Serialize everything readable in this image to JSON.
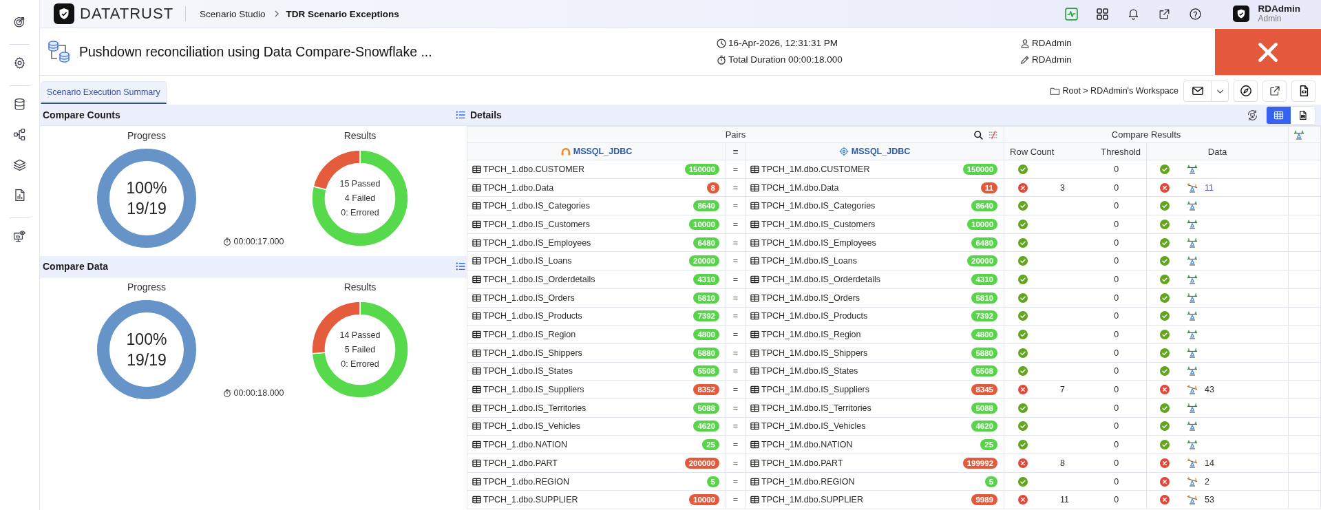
{
  "app_bar": {
    "logo": "DATATRUST",
    "breadcrumb": [
      {
        "label": "Scenario Studio",
        "current": false
      },
      {
        "label": "TDR Scenario Exceptions",
        "current": true
      }
    ],
    "user": {
      "name": "RDAdmin",
      "role": "Admin"
    }
  },
  "scenario": {
    "title": "Pushdown reconciliation using Data Compare-Snowflake ...",
    "run_time": "16-Apr-2026, 12:31:31 PM",
    "total_duration": "Total Duration 00:00:18.000",
    "owner": "RDAdmin",
    "modified_by": "RDAdmin",
    "failed": true
  },
  "tabs": [
    {
      "label": "Scenario Execution Summary",
      "selected": true
    }
  ],
  "workspace_path": "Root > RDAdmin's Workspace",
  "summary_panels": [
    {
      "title": "Compare Counts",
      "progress": {
        "label": "Progress",
        "percent": "100%",
        "count": "19/19",
        "level": 1
      },
      "results": {
        "label": "Results",
        "chart_data": {
          "type": "donut",
          "categories": [
            "15 Passed",
            "4 Failed",
            "0: Errored"
          ],
          "values": [
            15,
            4,
            0
          ]
        }
      },
      "elapsed": "00:00:17.000"
    },
    {
      "title": "Compare Data",
      "progress": {
        "label": "Progress",
        "percent": "100%",
        "count": "19/19",
        "level": 1
      },
      "results": {
        "label": "Results",
        "chart_data": {
          "type": "donut",
          "categories": [
            "14 Passed",
            "5 Failed",
            "0: Errored"
          ],
          "values": [
            14,
            5,
            0
          ]
        }
      },
      "elapsed": "00:00:18.000"
    }
  ],
  "details": {
    "title": "Details",
    "view_modes": [
      {
        "kind": "table",
        "selected": true
      },
      {
        "kind": "report",
        "selected": false
      }
    ],
    "group_headers": [
      "Pairs",
      "Compare Results"
    ],
    "columns": {
      "source": "MSSQL_JDBC",
      "operator": "=",
      "target": "MSSQL_JDBC",
      "row_count": "Row Count",
      "threshold": "Threshold",
      "data": "Data"
    },
    "rows": [
      {
        "source_table": "TPCH_1.dbo.CUSTOMER",
        "source_count": "150000",
        "operator": "=",
        "target_table": "TPCH_1M.dbo.CUSTOMER",
        "target_count": "150000",
        "row_count": {
          "passed": true,
          "threshold": "0"
        },
        "data": {
          "passed": true
        }
      },
      {
        "source_table": "TPCH_1.dbo.Data",
        "source_count": "8",
        "operator": "=",
        "target_table": "TPCH_1M.dbo.Data",
        "target_count": "11",
        "row_count": {
          "passed": false,
          "difference": "3",
          "threshold": "0"
        },
        "data": {
          "passed": false,
          "difference": "11",
          "link": true
        }
      },
      {
        "source_table": "TPCH_1.dbo.IS_Categories",
        "source_count": "8640",
        "operator": "=",
        "target_table": "TPCH_1M.dbo.IS_Categories",
        "target_count": "8640",
        "row_count": {
          "passed": true,
          "threshold": "0"
        },
        "data": {
          "passed": true
        }
      },
      {
        "source_table": "TPCH_1.dbo.IS_Customers",
        "source_count": "10000",
        "operator": "=",
        "target_table": "TPCH_1M.dbo.IS_Customers",
        "target_count": "10000",
        "row_count": {
          "passed": true,
          "threshold": "0"
        },
        "data": {
          "passed": true
        }
      },
      {
        "source_table": "TPCH_1.dbo.IS_Employees",
        "source_count": "6480",
        "operator": "=",
        "target_table": "TPCH_1M.dbo.IS_Employees",
        "target_count": "6480",
        "row_count": {
          "passed": true,
          "threshold": "0"
        },
        "data": {
          "passed": true
        }
      },
      {
        "source_table": "TPCH_1.dbo.IS_Loans",
        "source_count": "20000",
        "operator": "=",
        "target_table": "TPCH_1M.dbo.IS_Loans",
        "target_count": "20000",
        "row_count": {
          "passed": true,
          "threshold": "0"
        },
        "data": {
          "passed": true
        }
      },
      {
        "source_table": "TPCH_1.dbo.IS_Orderdetails",
        "source_count": "4310",
        "operator": "=",
        "target_table": "TPCH_1M.dbo.IS_Orderdetails",
        "target_count": "4310",
        "row_count": {
          "passed": true,
          "threshold": "0"
        },
        "data": {
          "passed": true
        }
      },
      {
        "source_table": "TPCH_1.dbo.IS_Orders",
        "source_count": "5810",
        "operator": "=",
        "target_table": "TPCH_1M.dbo.IS_Orders",
        "target_count": "5810",
        "row_count": {
          "passed": true,
          "threshold": "0"
        },
        "data": {
          "passed": true
        }
      },
      {
        "source_table": "TPCH_1.dbo.IS_Products",
        "source_count": "7392",
        "operator": "=",
        "target_table": "TPCH_1M.dbo.IS_Products",
        "target_count": "7392",
        "row_count": {
          "passed": true,
          "threshold": "0"
        },
        "data": {
          "passed": true
        }
      },
      {
        "source_table": "TPCH_1.dbo.IS_Region",
        "source_count": "4800",
        "operator": "=",
        "target_table": "TPCH_1M.dbo.IS_Region",
        "target_count": "4800",
        "row_count": {
          "passed": true,
          "threshold": "0"
        },
        "data": {
          "passed": true
        }
      },
      {
        "source_table": "TPCH_1.dbo.IS_Shippers",
        "source_count": "5880",
        "operator": "=",
        "target_table": "TPCH_1M.dbo.IS_Shippers",
        "target_count": "5880",
        "row_count": {
          "passed": true,
          "threshold": "0"
        },
        "data": {
          "passed": true
        }
      },
      {
        "source_table": "TPCH_1.dbo.IS_States",
        "source_count": "5508",
        "operator": "=",
        "target_table": "TPCH_1M.dbo.IS_States",
        "target_count": "5508",
        "row_count": {
          "passed": true,
          "threshold": "0"
        },
        "data": {
          "passed": true
        }
      },
      {
        "source_table": "TPCH_1.dbo.IS_Suppliers",
        "source_count": "8352",
        "operator": "=",
        "target_table": "TPCH_1M.dbo.IS_Suppliers",
        "target_count": "8345",
        "row_count": {
          "passed": false,
          "difference": "7",
          "threshold": "0"
        },
        "data": {
          "passed": false,
          "difference": "43",
          "link": false
        }
      },
      {
        "source_table": "TPCH_1.dbo.IS_Territories",
        "source_count": "5088",
        "operator": "=",
        "target_table": "TPCH_1M.dbo.IS_Territories",
        "target_count": "5088",
        "row_count": {
          "passed": true,
          "threshold": "0"
        },
        "data": {
          "passed": true
        }
      },
      {
        "source_table": "TPCH_1.dbo.IS_Vehicles",
        "source_count": "4620",
        "operator": "=",
        "target_table": "TPCH_1M.dbo.IS_Vehicles",
        "target_count": "4620",
        "row_count": {
          "passed": true,
          "threshold": "0"
        },
        "data": {
          "passed": true
        }
      },
      {
        "source_table": "TPCH_1.dbo.NATION",
        "source_count": "25",
        "operator": "=",
        "target_table": "TPCH_1M.dbo.NATION",
        "target_count": "25",
        "row_count": {
          "passed": true,
          "threshold": "0"
        },
        "data": {
          "passed": true
        }
      },
      {
        "source_table": "TPCH_1.dbo.PART",
        "source_count": "200000",
        "operator": "=",
        "target_table": "TPCH_1M.dbo.PART",
        "target_count": "199992",
        "row_count": {
          "passed": false,
          "difference": "8",
          "threshold": "0"
        },
        "data": {
          "passed": false,
          "difference": "14",
          "link": false
        }
      },
      {
        "source_table": "TPCH_1.dbo.REGION",
        "source_count": "5",
        "operator": "=",
        "target_table": "TPCH_1M.dbo.REGION",
        "target_count": "5",
        "row_count": {
          "passed": true,
          "threshold": "0"
        },
        "data": {
          "passed": false,
          "difference": "2",
          "link": false
        }
      },
      {
        "source_table": "TPCH_1.dbo.SUPPLIER",
        "source_count": "10000",
        "operator": "=",
        "target_table": "TPCH_1M.dbo.SUPPLIER",
        "target_count": "9989",
        "row_count": {
          "passed": false,
          "difference": "11",
          "threshold": "0"
        },
        "data": {
          "passed": false,
          "difference": "53",
          "link": false
        }
      }
    ]
  }
}
